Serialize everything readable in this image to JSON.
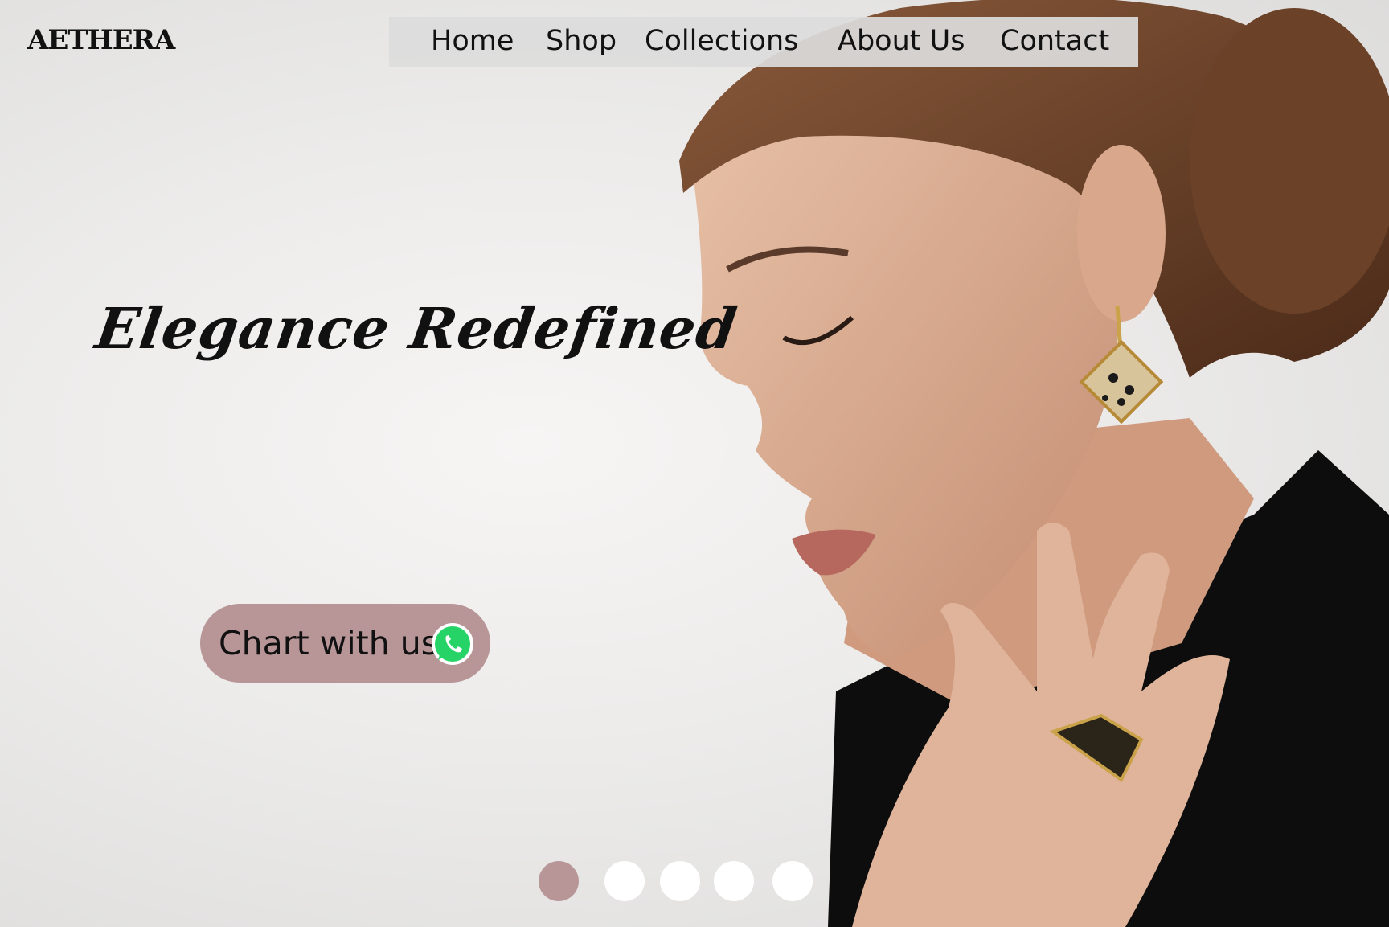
{
  "brand": {
    "logo_text": "AETHERA"
  },
  "nav": {
    "items": [
      {
        "label": "Home"
      },
      {
        "label": "Shop"
      },
      {
        "label": "Collections"
      },
      {
        "label": "About Us"
      },
      {
        "label": "Contact"
      }
    ]
  },
  "hero": {
    "headline": "Elegance Redefined",
    "chat_button_label": "Chart with us",
    "chat_icon": "whatsapp-icon"
  },
  "carousel": {
    "slide_count": 5,
    "active_index": 0
  },
  "colors": {
    "accent": "#b89698",
    "nav_bg": "#dcdcdc",
    "text": "#111111",
    "whatsapp": "#25d366"
  }
}
